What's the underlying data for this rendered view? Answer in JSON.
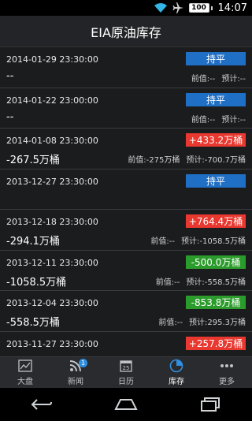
{
  "status": {
    "battery": "100",
    "time": "14:07"
  },
  "header": {
    "title": "EIA原油库存"
  },
  "rows": [
    {
      "date": "2014-01-29 23:30:00",
      "actual": "--",
      "badge": "持平",
      "badge_type": "flat",
      "prev": "前值:--",
      "forecast": "预计:--"
    },
    {
      "date": "2014-01-22 23:00:00",
      "actual": "--",
      "badge": "持平",
      "badge_type": "flat",
      "prev": "前值:--",
      "forecast": "预计:--"
    },
    {
      "date": "2014-01-08 23:30:00",
      "actual": "-267.5万桶",
      "badge": "+433.2万桶",
      "badge_type": "up",
      "prev": "前值:-275万桶",
      "forecast": "预计:-700.7万桶"
    },
    {
      "date": "2013-12-27 23:30:00",
      "actual": "",
      "badge": "持平",
      "badge_type": "flat",
      "prev": "",
      "forecast": ""
    },
    {
      "date": "2013-12-18 23:30:00",
      "actual": "-294.1万桶",
      "badge": "+764.4万桶",
      "badge_type": "up",
      "prev": "前值:--",
      "forecast": "预计:-1058.5万桶"
    },
    {
      "date": "2013-12-11 23:30:00",
      "actual": "-1058.5万桶",
      "badge": "-500.0万桶",
      "badge_type": "down",
      "prev": "前值:--",
      "forecast": "预计:-558.5万桶"
    },
    {
      "date": "2013-12-04 23:30:00",
      "actual": "-558.5万桶",
      "badge": "-853.8万桶",
      "badge_type": "down",
      "prev": "前值:--",
      "forecast": "预计:295.3万桶"
    },
    {
      "date": "2013-11-27 23:30:00",
      "actual": "",
      "badge": "+257.8万桶",
      "badge_type": "up",
      "prev": "",
      "forecast": ""
    }
  ],
  "tabs": [
    {
      "label": "大盘",
      "icon": "chart-icon"
    },
    {
      "label": "新闻",
      "icon": "rss-icon",
      "badge": "1"
    },
    {
      "label": "日历",
      "icon": "calendar-icon"
    },
    {
      "label": "库存",
      "icon": "pie-icon",
      "active": true
    },
    {
      "label": "更多",
      "icon": "more-icon"
    }
  ]
}
